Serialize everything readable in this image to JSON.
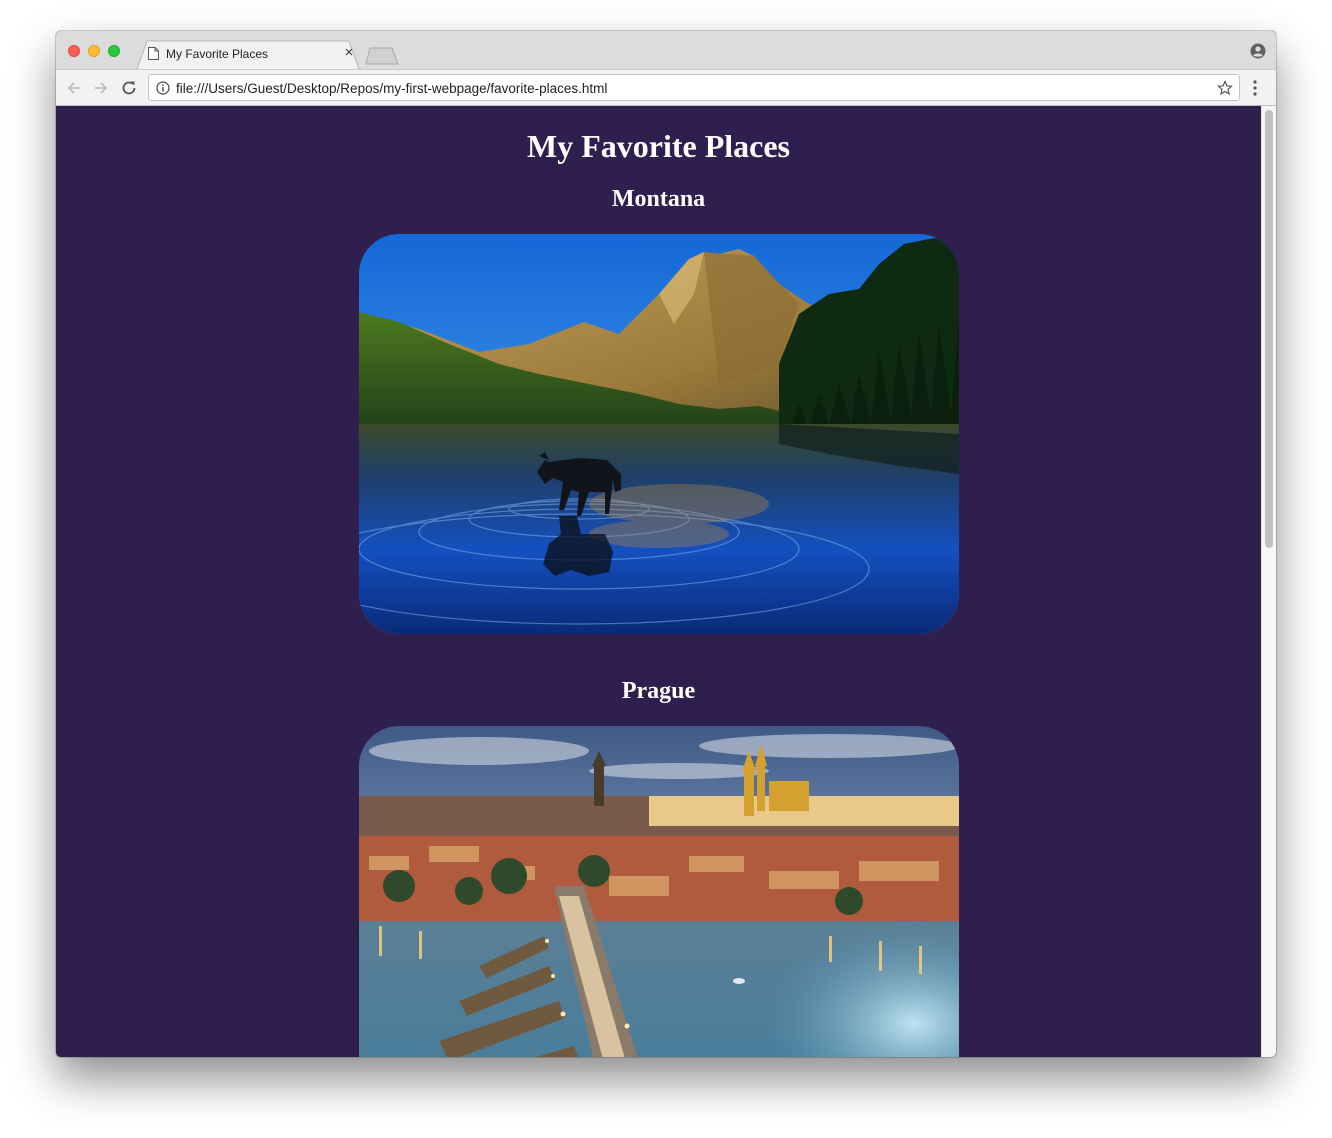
{
  "browser": {
    "tab_title": "My Favorite Places",
    "tab_close": "×",
    "url": "file:///Users/Guest/Desktop/Repos/my-first-webpage/favorite-places.html"
  },
  "page": {
    "title": "My Favorite Places",
    "background_color": "#2f1f4e",
    "places": [
      {
        "name": "Montana"
      },
      {
        "name": "Prague"
      }
    ]
  }
}
